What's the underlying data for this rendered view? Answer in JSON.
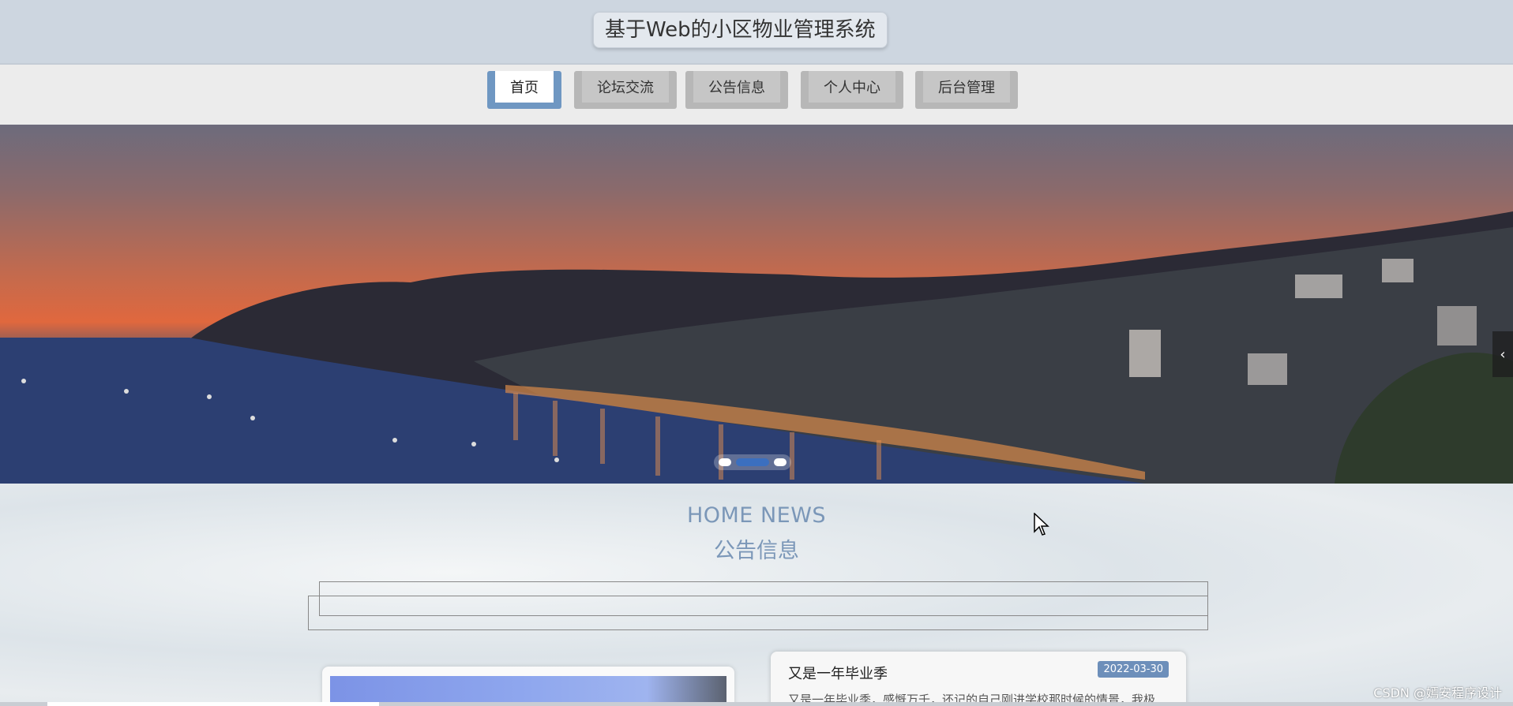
{
  "header": {
    "title": "基于Web的小区物业管理系统"
  },
  "nav": {
    "items": [
      {
        "label": "首页",
        "active": true
      },
      {
        "label": "论坛交流",
        "active": false
      },
      {
        "label": "公告信息",
        "active": false
      },
      {
        "label": "个人中心",
        "active": false
      },
      {
        "label": "后台管理",
        "active": false
      }
    ]
  },
  "carousel": {
    "arrow_icon": "chevron-left-icon",
    "dot_count": 3,
    "active_dot": 1
  },
  "news": {
    "heading_en": "HOME NEWS",
    "heading_cn": "公告信息",
    "items": [
      {
        "title": "又是一年毕业季",
        "date": "2022-03-30",
        "excerpt": "又是一年毕业季，感慨万千，还记的自己刚进学校那时候的情景，我极"
      }
    ]
  },
  "watermark": "CSDN @嫣安程序设计",
  "colors": {
    "header_bg": "#cdd6e0",
    "nav_active": "#6f97c2",
    "heading": "#7b97b8",
    "date_badge": "#6d8fba"
  }
}
